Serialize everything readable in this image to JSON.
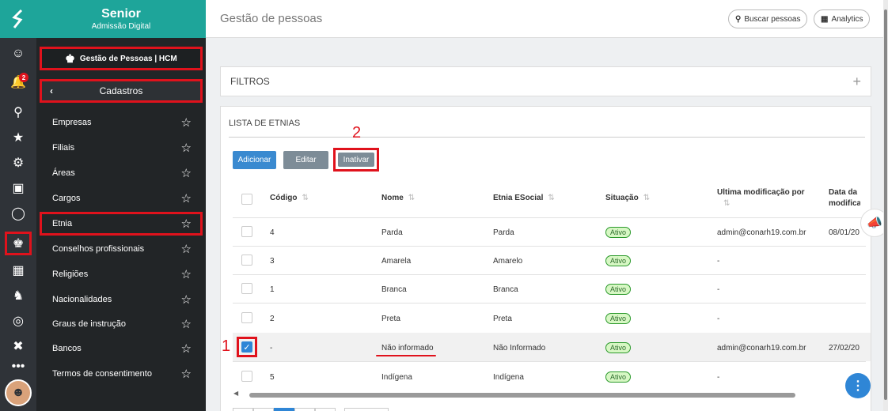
{
  "brand": {
    "name": "Senior",
    "sub": "Admissão Digital",
    "logo_icon": "senior-s-logo"
  },
  "notifications": {
    "count": "2"
  },
  "menu": {
    "module": "Gestão de Pessoas | HCM",
    "section": "Cadastros",
    "items": [
      {
        "label": "Empresas"
      },
      {
        "label": "Filiais"
      },
      {
        "label": "Áreas"
      },
      {
        "label": "Cargos"
      },
      {
        "label": "Etnia"
      },
      {
        "label": "Conselhos profissionais"
      },
      {
        "label": "Religiões"
      },
      {
        "label": "Nacionalidades"
      },
      {
        "label": "Graus de instrução"
      },
      {
        "label": "Bancos"
      },
      {
        "label": "Termos de consentimento"
      }
    ]
  },
  "header": {
    "title": "Gestão de pessoas",
    "search_label": "Buscar pessoas",
    "analytics_label": "Analytics"
  },
  "filters": {
    "label": "FILTROS"
  },
  "list": {
    "title": "LISTA DE ETNIAS",
    "buttons": {
      "add": "Adicionar",
      "edit": "Editar",
      "inactivate": "Inativar"
    },
    "columns": [
      "Código",
      "Nome",
      "Etnia ESocial",
      "Situação",
      "Ultima modificação por",
      "Data da modifica"
    ],
    "rows": [
      {
        "code": "4",
        "name": "Parda",
        "esocial": "Parda",
        "status": "Ativo",
        "modified_by": "admin@conarh19.com.br",
        "date": "08/01/20"
      },
      {
        "code": "3",
        "name": "Amarela",
        "esocial": "Amarelo",
        "status": "Ativo",
        "modified_by": "-",
        "date": ""
      },
      {
        "code": "1",
        "name": "Branca",
        "esocial": "Branca",
        "status": "Ativo",
        "modified_by": "-",
        "date": ""
      },
      {
        "code": "2",
        "name": "Preta",
        "esocial": "Preta",
        "status": "Ativo",
        "modified_by": "-",
        "date": ""
      },
      {
        "code": "-",
        "name": "Não informado",
        "esocial": "Não Informado",
        "status": "Ativo",
        "modified_by": "admin@conarh19.com.br",
        "date": "27/02/20"
      },
      {
        "code": "5",
        "name": "Indígena",
        "esocial": "Indígena",
        "status": "Ativo",
        "modified_by": "-",
        "date": ""
      }
    ]
  },
  "annotations": {
    "step1": "1",
    "step2": "2"
  },
  "colors": {
    "teal": "#1ea59a",
    "annotation_red": "#e0121c",
    "primary_blue": "#2f86d6"
  }
}
